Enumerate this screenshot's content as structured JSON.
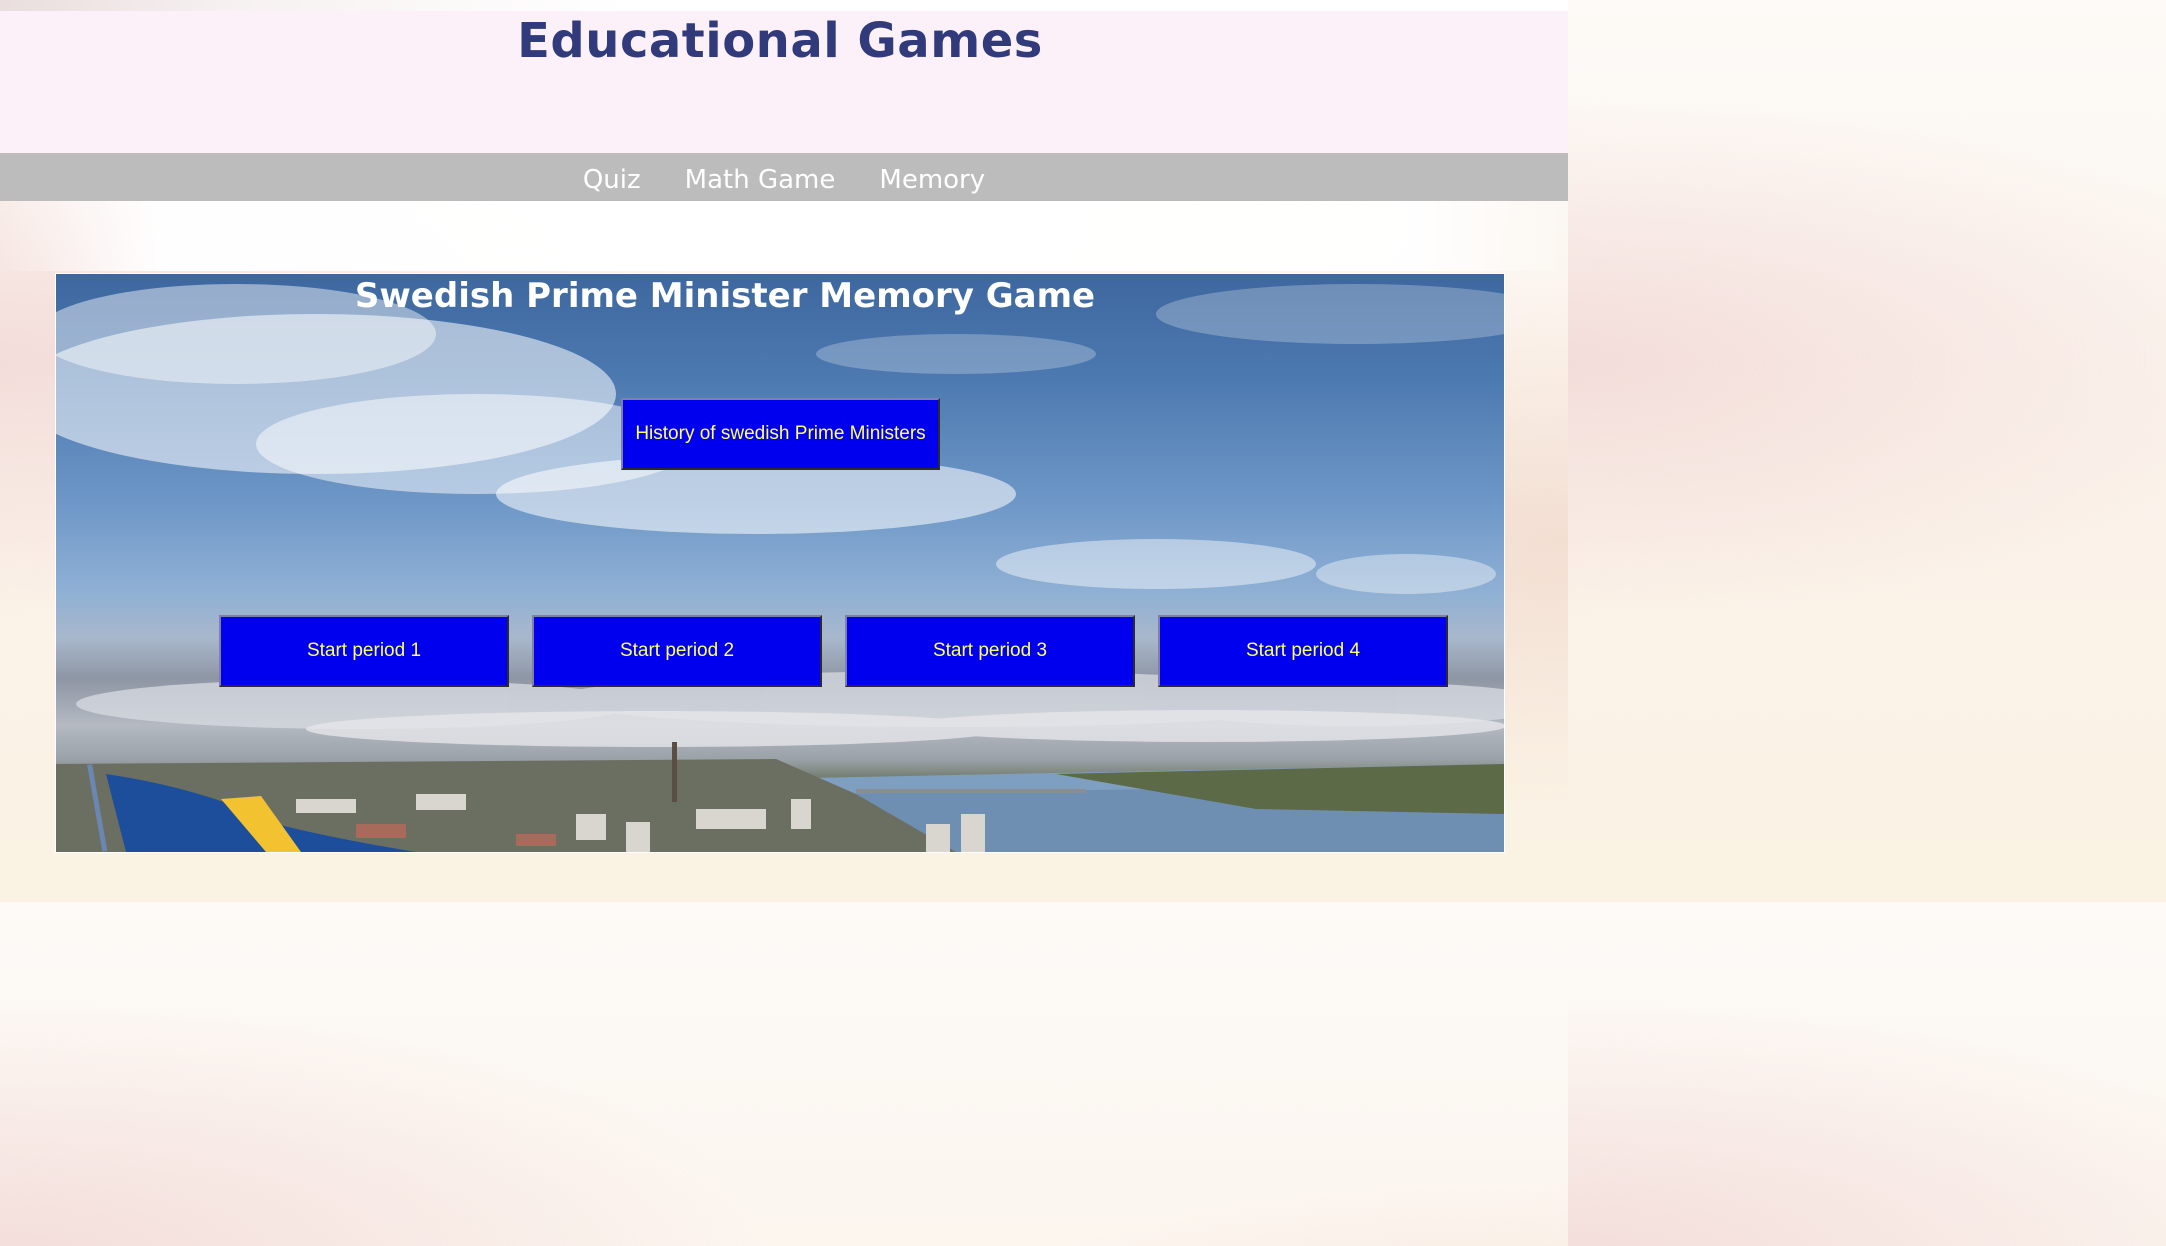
{
  "header": {
    "site_title": "Educational Games"
  },
  "nav": {
    "items": [
      {
        "label": "Quiz"
      },
      {
        "label": "Math Game"
      },
      {
        "label": "Memory"
      }
    ]
  },
  "game": {
    "title": "Swedish Prime Minister Memory Game",
    "history_button": "History of swedish Prime Ministers",
    "period_buttons": [
      {
        "label": "Start period 1"
      },
      {
        "label": "Start period 2"
      },
      {
        "label": "Start period 3"
      },
      {
        "label": "Start period 4"
      }
    ]
  },
  "colors": {
    "title": "#313a7a",
    "header_bg": "#fcf1f8",
    "nav_bg": "#bcbcbc",
    "button_bg": "#0000ee",
    "button_text": "#ffff66"
  }
}
